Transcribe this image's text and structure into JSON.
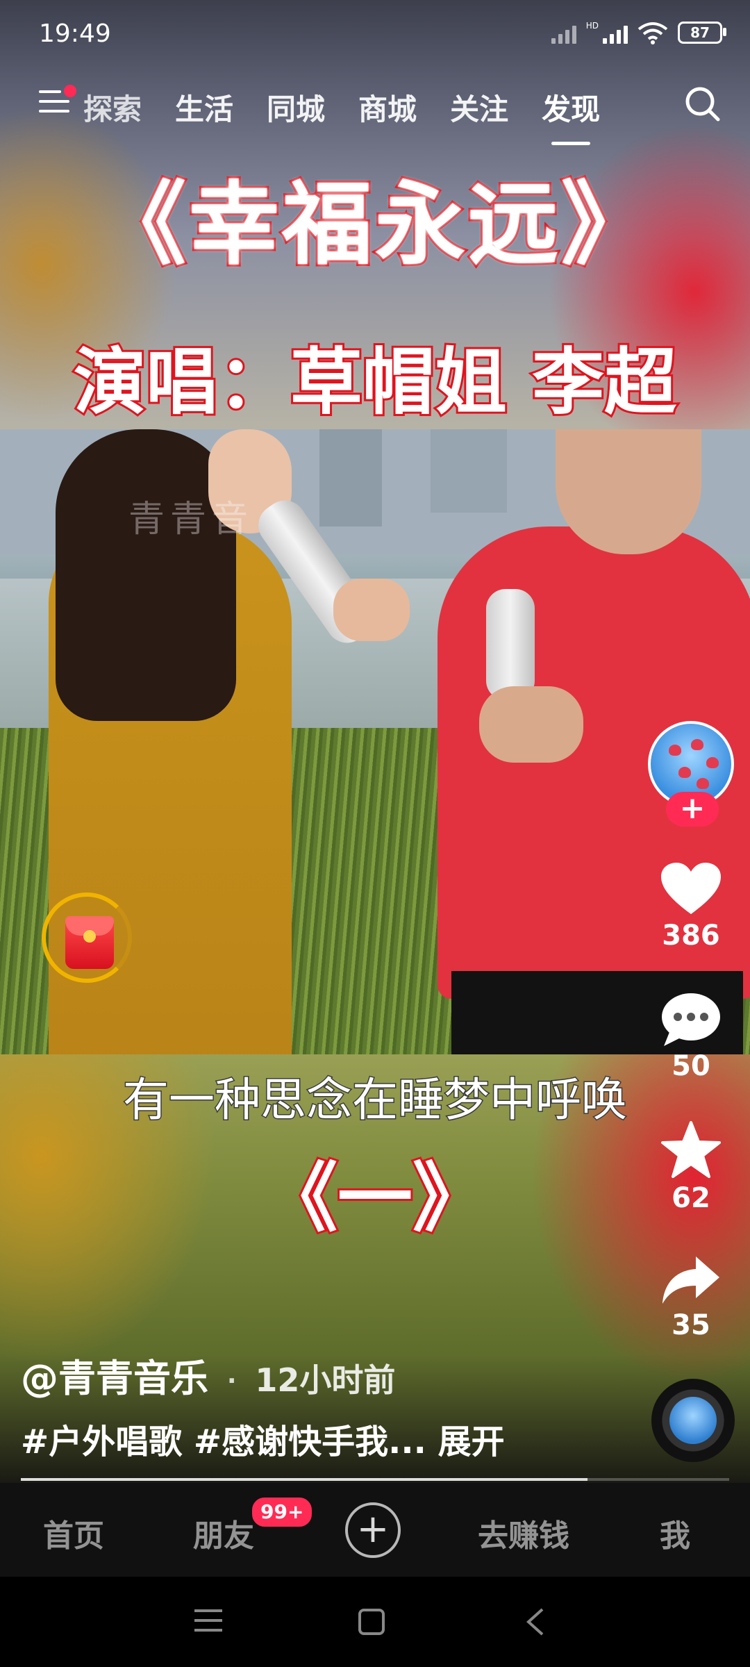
{
  "status_bar": {
    "time": "19:49",
    "network_label": "HD",
    "battery": "87"
  },
  "top_nav": {
    "tabs": [
      {
        "label": "探索"
      },
      {
        "label": "生活"
      },
      {
        "label": "同城"
      },
      {
        "label": "商城"
      },
      {
        "label": "关注"
      },
      {
        "label": "发现",
        "active": true
      }
    ],
    "menu_icon": "hamburger-icon",
    "search_icon": "search-icon"
  },
  "video": {
    "title_song": "《幸福永远》",
    "title_singers": "演唱：草帽姐 李超",
    "watermark": "青青音",
    "subtitle": "有一种思念在睡梦中呼唤",
    "part_label": "《一》"
  },
  "actions": {
    "follow_label": "+",
    "like_count": "386",
    "comment_count": "50",
    "favorite_count": "62",
    "share_count": "35"
  },
  "caption": {
    "author": "@青青音乐",
    "separator": "·",
    "time": "12小时前",
    "text": "#户外唱歌 #感谢快手我... 展开"
  },
  "progress": 0.8,
  "bottom_nav": {
    "home": "首页",
    "friends": "朋友",
    "friends_badge": "99+",
    "create": "+",
    "earn": "去赚钱",
    "me": "我"
  },
  "colors": {
    "accent": "#ff2b55",
    "title_stroke": "#e0141e",
    "redpacket_ring": "#f0b400"
  }
}
